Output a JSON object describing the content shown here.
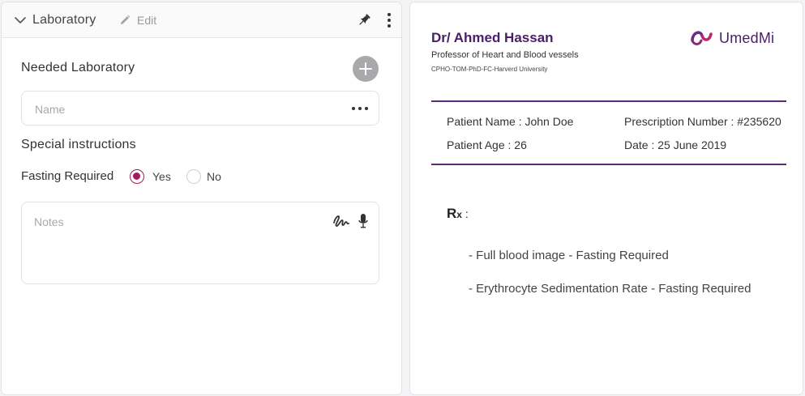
{
  "laboratory_panel": {
    "title": "Laboratory",
    "edit_label": "Edit",
    "needed_label": "Needed Laboratory",
    "name_placeholder": "Name",
    "special_instructions_label": "Special instructions",
    "fasting_label": "Fasting Required",
    "fasting_options": [
      "Yes",
      "No"
    ],
    "fasting_selected": "Yes",
    "notes_placeholder": "Notes"
  },
  "prescription": {
    "doctor_name": "Dr/ Ahmed Hassan",
    "doctor_title": "Professor of Heart and Blood vessels",
    "doctor_credentials": "CPHO-TOM-PhD-FC-Harverd University",
    "logo_text": "UmedMi",
    "patient_name": "Patient Name :   John Doe",
    "patient_age": "Patient Age :   26",
    "prescription_number": "Prescription Number : #235620",
    "date": "Date : 25 June 2019",
    "rx_main": "R",
    "rx_sub": "x",
    "rx_colon": " :",
    "items": [
      "-  Full blood image  - Fasting Required",
      "-  Erythrocyte Sedimentation Rate  -  Fasting Required"
    ]
  },
  "colors": {
    "accent": "#a01c5a",
    "brand_purple": "#4a1d6b",
    "divider": "#5c2a78"
  },
  "icons": [
    "chevron-down-icon",
    "pencil-icon",
    "pin-icon",
    "more-vertical-icon",
    "plus-icon",
    "more-horizontal-icon",
    "signature-icon",
    "microphone-icon",
    "umedmi-logo-icon"
  ]
}
